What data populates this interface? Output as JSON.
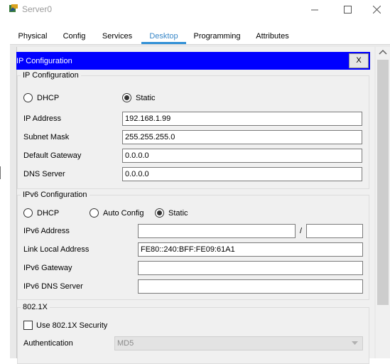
{
  "window": {
    "title": "Server0",
    "app_icon": "packet-tracer-server-icon",
    "controls": [
      "minimize-icon",
      "maximize-icon",
      "close-icon"
    ]
  },
  "tabs": [
    {
      "label": "Physical",
      "active": false
    },
    {
      "label": "Config",
      "active": false
    },
    {
      "label": "Services",
      "active": false
    },
    {
      "label": "Desktop",
      "active": true
    },
    {
      "label": "Programming",
      "active": false
    },
    {
      "label": "Attributes",
      "active": false
    }
  ],
  "ipconfig": {
    "header_title": "IP Configuration",
    "close_label": "X",
    "ipv4": {
      "legend": "IP Configuration",
      "dhcp_label": "DHCP",
      "static_label": "Static",
      "selected": "Static",
      "ip_label": "IP Address",
      "ip_value": "192.168.1.99",
      "mask_label": "Subnet Mask",
      "mask_value": "255.255.255.0",
      "gateway_label": "Default Gateway",
      "gateway_value": "0.0.0.0",
      "dns_label": "DNS Server",
      "dns_value": "0.0.0.0"
    },
    "ipv6": {
      "legend": "IPv6 Configuration",
      "dhcp_label": "DHCP",
      "auto_label": "Auto Config",
      "static_label": "Static",
      "selected": "Static",
      "addr_label": "IPv6 Address",
      "addr_value": "",
      "prefix_separator": "/",
      "prefix_value": "",
      "link_local_label": "Link Local Address",
      "link_local_value": "FE80::240:BFF:FE09:61A1",
      "gateway_label": "IPv6 Gateway",
      "gateway_value": "",
      "dns_label": "IPv6 DNS Server",
      "dns_value": ""
    },
    "dot1x": {
      "legend": "802.1X",
      "use_label": "Use 802.1X Security",
      "use_checked": false,
      "auth_label": "Authentication",
      "auth_value": "MD5"
    }
  },
  "colors": {
    "header_bar": "#0000ff",
    "active_tab_text": "#3a88c8",
    "active_tab_underline": "#2f8fd6"
  }
}
